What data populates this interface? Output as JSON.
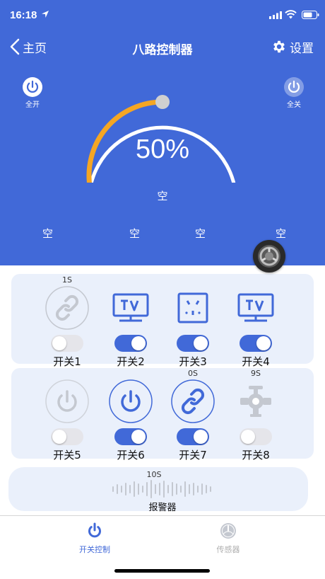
{
  "status_bar": {
    "time": "16:18"
  },
  "nav": {
    "back_label": "主页",
    "title": "八路控制器",
    "settings_label": "设置"
  },
  "controls": {
    "all_on_label": "全开",
    "all_off_label": "全关"
  },
  "gauge": {
    "percent_text": "50%",
    "value_fraction": 0.5,
    "center_label": "空"
  },
  "slots": [
    "空",
    "空",
    "空",
    "空"
  ],
  "switches": [
    {
      "label": "开关1",
      "timer": "1S",
      "on": false,
      "icon": "link-icon"
    },
    {
      "label": "开关2",
      "timer": "",
      "on": true,
      "icon": "tv-icon"
    },
    {
      "label": "开关3",
      "timer": "",
      "on": true,
      "icon": "outlet-icon"
    },
    {
      "label": "开关4",
      "timer": "",
      "on": true,
      "icon": "tv-icon"
    },
    {
      "label": "开关5",
      "timer": "",
      "on": false,
      "icon": "power-icon"
    },
    {
      "label": "开关6",
      "timer": "",
      "on": true,
      "icon": "power-icon"
    },
    {
      "label": "开关7",
      "timer": "0S",
      "on": true,
      "icon": "link-icon"
    },
    {
      "label": "开关8",
      "timer": "9S",
      "on": false,
      "icon": "valve-icon"
    }
  ],
  "alarm": {
    "timer": "10S",
    "label": "报警器"
  },
  "tabs": [
    {
      "label": "开关控制",
      "icon": "power-icon",
      "active": true
    },
    {
      "label": "传感器",
      "icon": "gauge-icon",
      "active": false
    }
  ],
  "colors": {
    "primary": "#4169d8",
    "accent_arc": "#f5a623",
    "card_bg": "#eaf0fb",
    "inactive": "#c7c7cc"
  }
}
